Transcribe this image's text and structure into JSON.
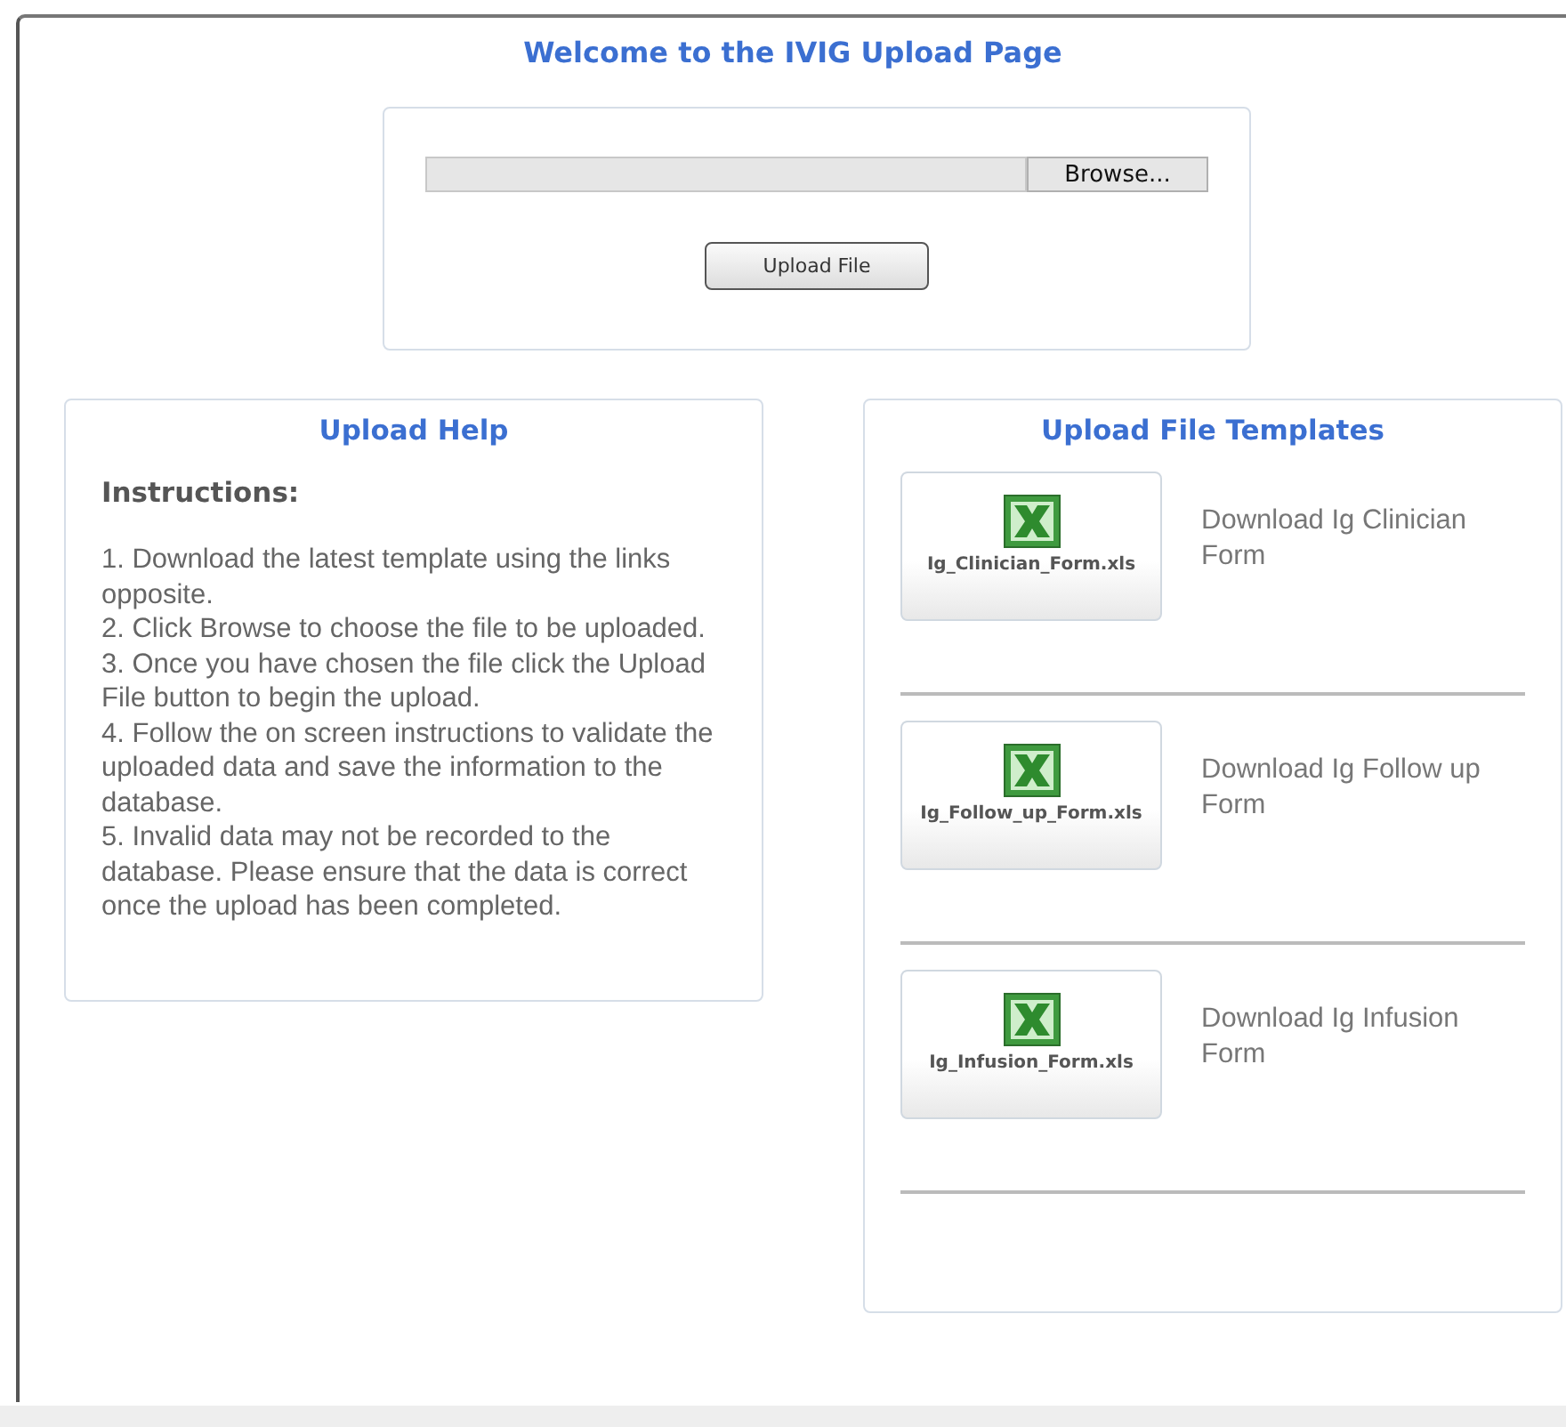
{
  "page_title": "Welcome to the IVIG Upload Page",
  "upload": {
    "browse_button": "Browse...",
    "upload_button": "Upload File"
  },
  "help": {
    "title": "Upload Help",
    "heading": "Instructions:",
    "steps": [
      "1. Download the latest template using the links opposite.",
      "2. Click Browse to choose the file to be uploaded.",
      "3. Once you have chosen the file click the Upload File button to begin the upload.",
      "4. Follow the on screen instructions to validate the uploaded data and save the information to the database.",
      "5. Invalid data may not be recorded to the database. Please ensure that the data is correct once the upload has been completed."
    ]
  },
  "templates": {
    "title": "Upload File Templates",
    "items": [
      {
        "file": "Ig_Clinician_Form.xls",
        "link": "Download Ig Clinician Form"
      },
      {
        "file": "Ig_Follow_up_Form.xls",
        "link": "Download Ig Follow up Form"
      },
      {
        "file": "Ig_Infusion_Form.xls",
        "link": "Download Ig Infusion Form"
      }
    ]
  }
}
